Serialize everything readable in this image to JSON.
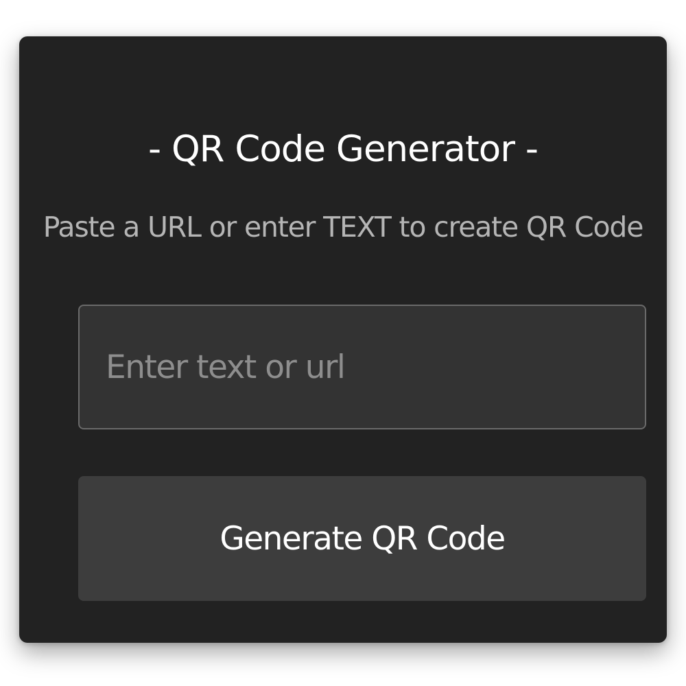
{
  "app": {
    "title": "- QR Code Generator -",
    "subtitle": "Paste a URL or enter TEXT to create QR Code"
  },
  "form": {
    "input_value": "",
    "input_placeholder": "Enter text or url",
    "generate_label": "Generate QR Code"
  },
  "colors": {
    "page_background": "#ffffff",
    "card_background": "#222222",
    "input_background": "#333333",
    "input_border": "#6a6a6a",
    "button_background": "#3d3d3d",
    "title_text": "#ffffff",
    "subtitle_text": "#b5b5b5",
    "placeholder_text": "#8e8e8e"
  }
}
